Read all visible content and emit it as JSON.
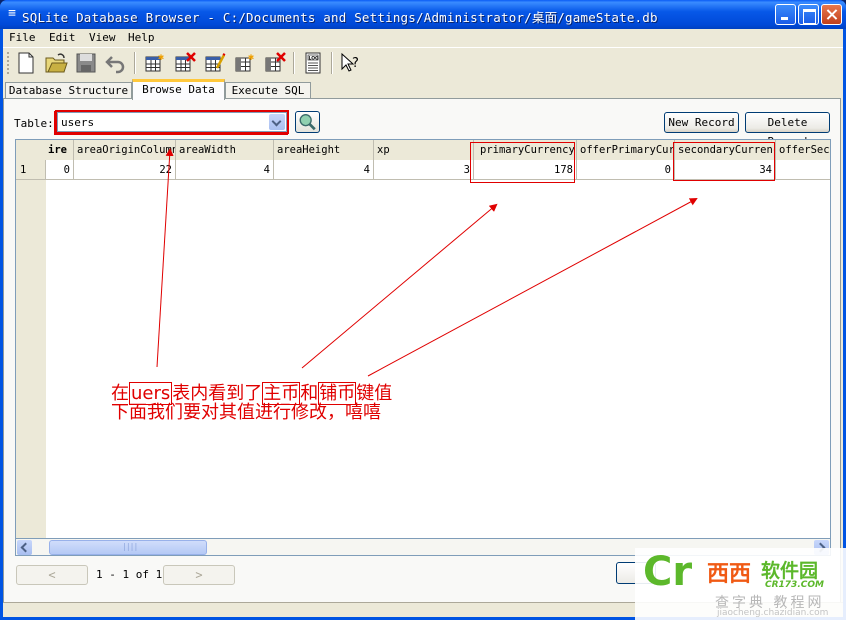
{
  "window": {
    "title": "SQLite Database Browser - C:/Documents and Settings/Administrator/桌面/gameState.db",
    "app_icon": "database-icon",
    "controls": [
      "minimize",
      "maximize",
      "close"
    ]
  },
  "menu": {
    "items": [
      {
        "label": "File"
      },
      {
        "label": "Edit"
      },
      {
        "label": "View"
      },
      {
        "label": "Help"
      }
    ]
  },
  "toolbar": {
    "tools": [
      {
        "name": "new-database",
        "icon": "new-file-icon"
      },
      {
        "name": "open-database",
        "icon": "open-folder-icon"
      },
      {
        "name": "save-database",
        "icon": "save-disk-icon"
      },
      {
        "name": "revert",
        "icon": "undo-icon"
      },
      {
        "name": "create-table",
        "icon": "table-new-icon"
      },
      {
        "name": "delete-table",
        "icon": "table-delete-icon"
      },
      {
        "name": "modify-table",
        "icon": "table-edit-icon"
      },
      {
        "name": "create-index",
        "icon": "index-new-icon"
      },
      {
        "name": "delete-index",
        "icon": "index-delete-icon"
      },
      {
        "name": "sql-log",
        "icon": "log-icon"
      },
      {
        "name": "whats-this",
        "icon": "help-pointer-icon"
      }
    ]
  },
  "tabs": [
    {
      "label": "Database Structure",
      "active": false
    },
    {
      "label": "Browse Data",
      "active": true
    },
    {
      "label": "Execute SQL",
      "active": false
    }
  ],
  "browse": {
    "table_label": "Table:",
    "table_selected": "users",
    "new_record_label": "New Record",
    "delete_record_label": "Delete Record",
    "columns": [
      "ire",
      "areaOriginColumn",
      "areaWidth",
      "areaHeight",
      "xp",
      "primaryCurrency",
      "offerPrimaryCurrency",
      "secondaryCurrency",
      "offerSeco"
    ],
    "rows": [
      {
        "row_num": "1",
        "values": [
          "0",
          "22",
          "4",
          "4",
          "3",
          "178",
          "0",
          "34",
          ""
        ]
      }
    ],
    "prev_label": "<",
    "next_label": ">",
    "page_info": "1 - 1 of 1"
  },
  "annotation": {
    "line1_parts": [
      "在",
      "uers",
      "表内看到了",
      "主币",
      "和",
      "铺币",
      "键值"
    ],
    "line2": "下面我们要对其值进行修改，嘻嘻",
    "color": "#e00000"
  },
  "watermark": {
    "logo": "Cr",
    "name_orange": "西西",
    "name_green": "软件园",
    "domain": "CR173.COM",
    "sub": "查字典 教程网",
    "url": "jiaocheng.chazidian.com"
  }
}
